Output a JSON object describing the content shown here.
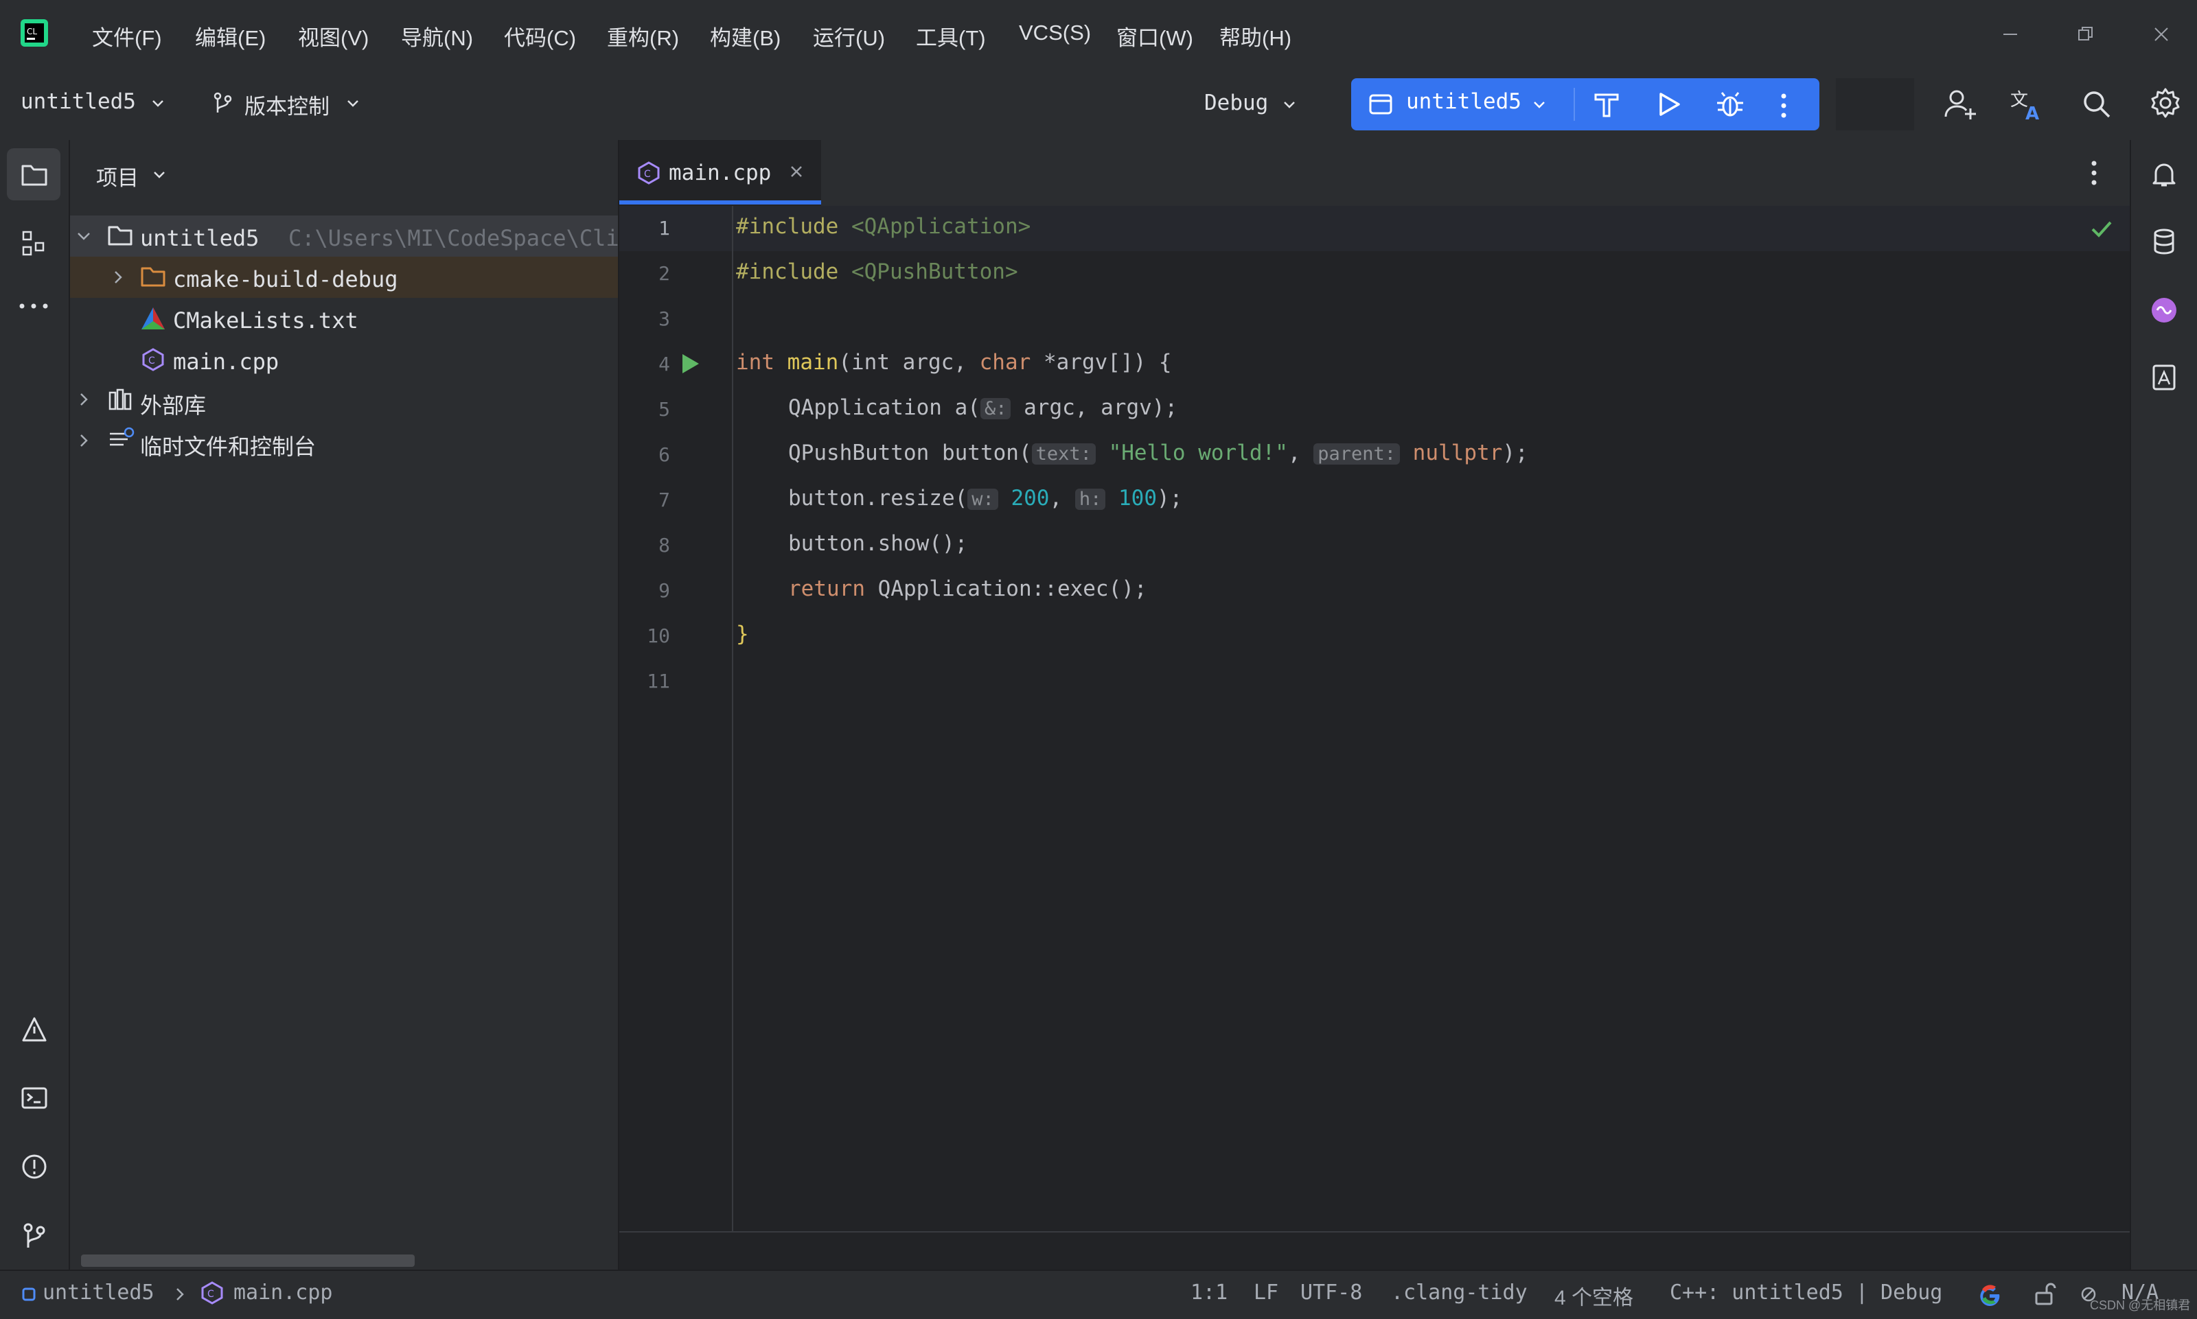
{
  "menu": [
    {
      "label": "文件(F)"
    },
    {
      "label": "编辑(E)"
    },
    {
      "label": "视图(V)"
    },
    {
      "label": "导航(N)"
    },
    {
      "label": "代码(C)"
    },
    {
      "label": "重构(R)"
    },
    {
      "label": "构建(B)"
    },
    {
      "label": "运行(U)"
    },
    {
      "label": "工具(T)"
    },
    {
      "label": "VCS(S)"
    },
    {
      "label": "窗口(W)"
    },
    {
      "label": "帮助(H)"
    }
  ],
  "toolbar": {
    "project_name": "untitled5",
    "vcs_label": "版本控制",
    "config": "Debug",
    "run_target": "untitled5"
  },
  "project_panel": {
    "title": "项目",
    "root": {
      "name": "untitled5",
      "path": "C:\\Users\\MI\\CodeSpace\\Cli"
    },
    "items": [
      {
        "label": "cmake-build-debug"
      },
      {
        "label": "CMakeLists.txt"
      },
      {
        "label": "main.cpp"
      },
      {
        "label": "外部库"
      },
      {
        "label": "临时文件和控制台"
      }
    ]
  },
  "editor": {
    "tab": "main.cpp",
    "line_numbers": [
      "1",
      "2",
      "3",
      "4",
      "5",
      "6",
      "7",
      "8",
      "9",
      "10",
      "11"
    ]
  },
  "code": {
    "l1_kw": "#include",
    "l1_inc": "<QApplication>",
    "l2_kw": "#include",
    "l2_inc": "<QPushButton>",
    "l4_a": "int",
    "l4_b": "main",
    "l4_c": "(int argc, ",
    "l4_d": "char",
    "l4_e": " *argv[]) {",
    "l5_a": "QApplication a(",
    "l5_hint": "&:",
    "l5_b": " argc, argv);",
    "l6_a": "QPushButton button(",
    "l6_hint1": "text:",
    "l6_str": "\"Hello world!\"",
    "l6_comma": ",",
    "l6_hint2": "parent:",
    "l6_null": "nullptr",
    "l6_end": ");",
    "l7_a": "button.resize(",
    "l7_hint1": "w:",
    "l7_n1": "200",
    "l7_comma": ",",
    "l7_hint2": "h:",
    "l7_n2": "100",
    "l7_end": ");",
    "l8": "button.show();",
    "l9_kw": "return",
    "l9_rest": " QApplication::exec();",
    "l10": "}"
  },
  "status": {
    "project": "untitled5",
    "file": "main.cpp",
    "position": "1:1",
    "line_sep": "LF",
    "encoding": "UTF-8",
    "formatter": ".clang-tidy",
    "indent": "4 个空格",
    "context": "C++: untitled5 | Debug",
    "na": "N/A"
  },
  "watermark": "CSDN @无相镇君",
  "colors": {
    "accent": "#3574f0",
    "bg": "#1e1f22",
    "panel": "#2b2d30"
  }
}
